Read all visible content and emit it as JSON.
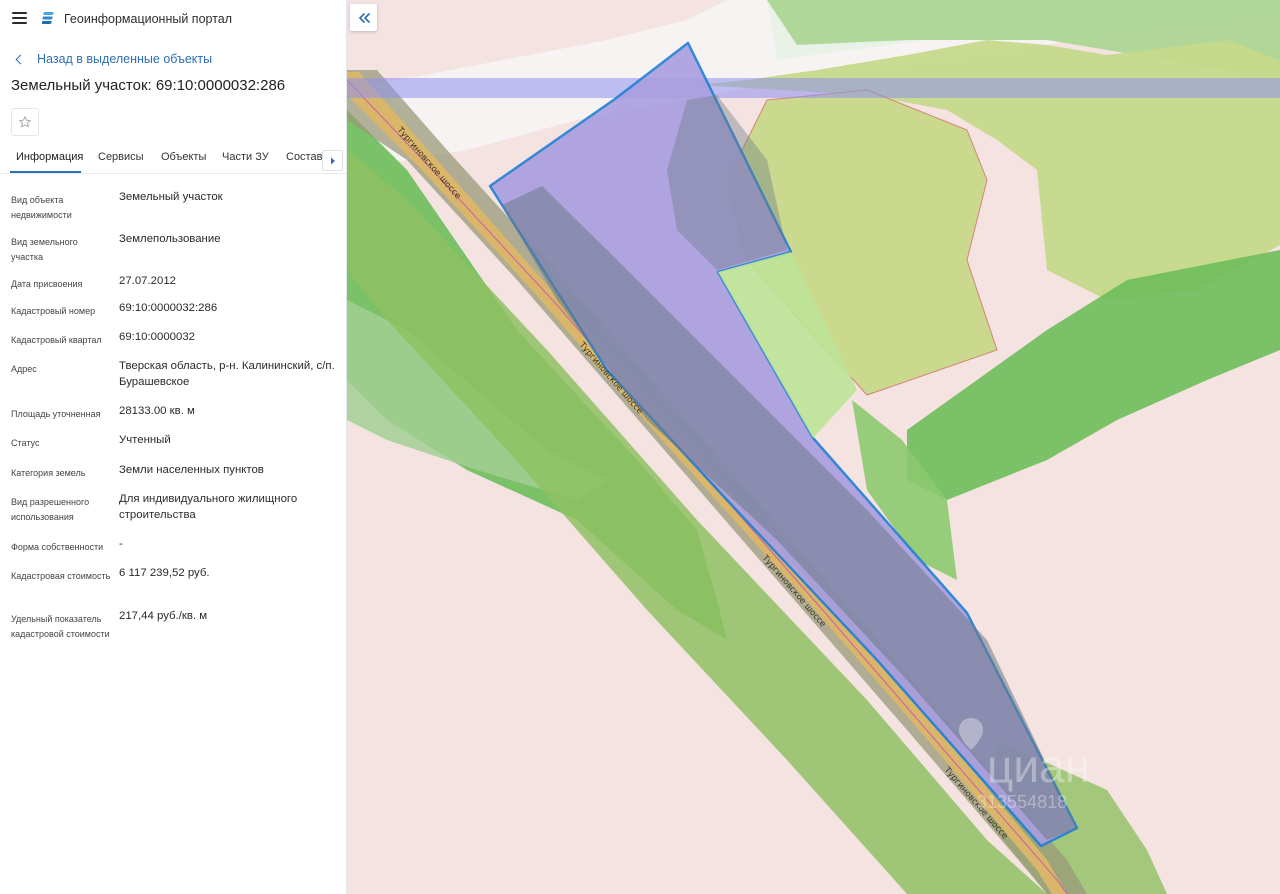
{
  "header": {
    "app_title": "Геоинформационный портал",
    "menu_icon": "hamburger-menu-icon",
    "logo_icon": "portal-logo-icon"
  },
  "back_link": {
    "label": "Назад в выделенные объекты"
  },
  "object": {
    "title": "Земельный участок: 69:10:0000032:286"
  },
  "tabs": [
    {
      "label": "Информация",
      "active": true
    },
    {
      "label": "Сервисы",
      "active": false
    },
    {
      "label": "Объекты",
      "active": false
    },
    {
      "label": "Части ЗУ",
      "active": false
    },
    {
      "label": "Состав",
      "active": false
    }
  ],
  "info": [
    {
      "label": "Вид объекта недвижимости",
      "value": "Земельный участок"
    },
    {
      "label": "Вид земельного участка",
      "value": "Землепользование"
    },
    {
      "label": "Дата присвоения",
      "value": "27.07.2012"
    },
    {
      "label": "Кадастровый номер",
      "value": "69:10:0000032:286"
    },
    {
      "label": "Кадастровый квартал",
      "value": "69:10:0000032"
    },
    {
      "label": "Адрес",
      "value": "Тверская область, р-н. Калининский, с/п. Бурашевское"
    },
    {
      "label": "Площадь уточненная",
      "value": "28133.00 кв. м"
    },
    {
      "label": "Статус",
      "value": "Учтенный"
    },
    {
      "label": "Категория земель",
      "value": "Земли населенных пунктов"
    },
    {
      "label": "Вид разрешенного использования",
      "value": "Для индивидуального жилищного строительства"
    },
    {
      "label": "Форма собственности",
      "value": "-"
    },
    {
      "label": "Кадастровая стоимость",
      "value": "6 117 239,52 руб."
    },
    {
      "label": "Удельный показатель кадастровой стоимости",
      "value": "217,44 руб./кв. м"
    }
  ],
  "map": {
    "road_name": "Тургиновское шоссе",
    "watermark_brand": "циан",
    "watermark_id": "313554818",
    "collapse_icon": "double-chevron-left-icon",
    "colors": {
      "background": "#f4e3e0",
      "forest": "#7cc46a",
      "field": "#c9d98a",
      "parcel_fill": "#a99ee0",
      "parcel_outline": "#1f7fd6",
      "road": "#d9b66a"
    }
  }
}
